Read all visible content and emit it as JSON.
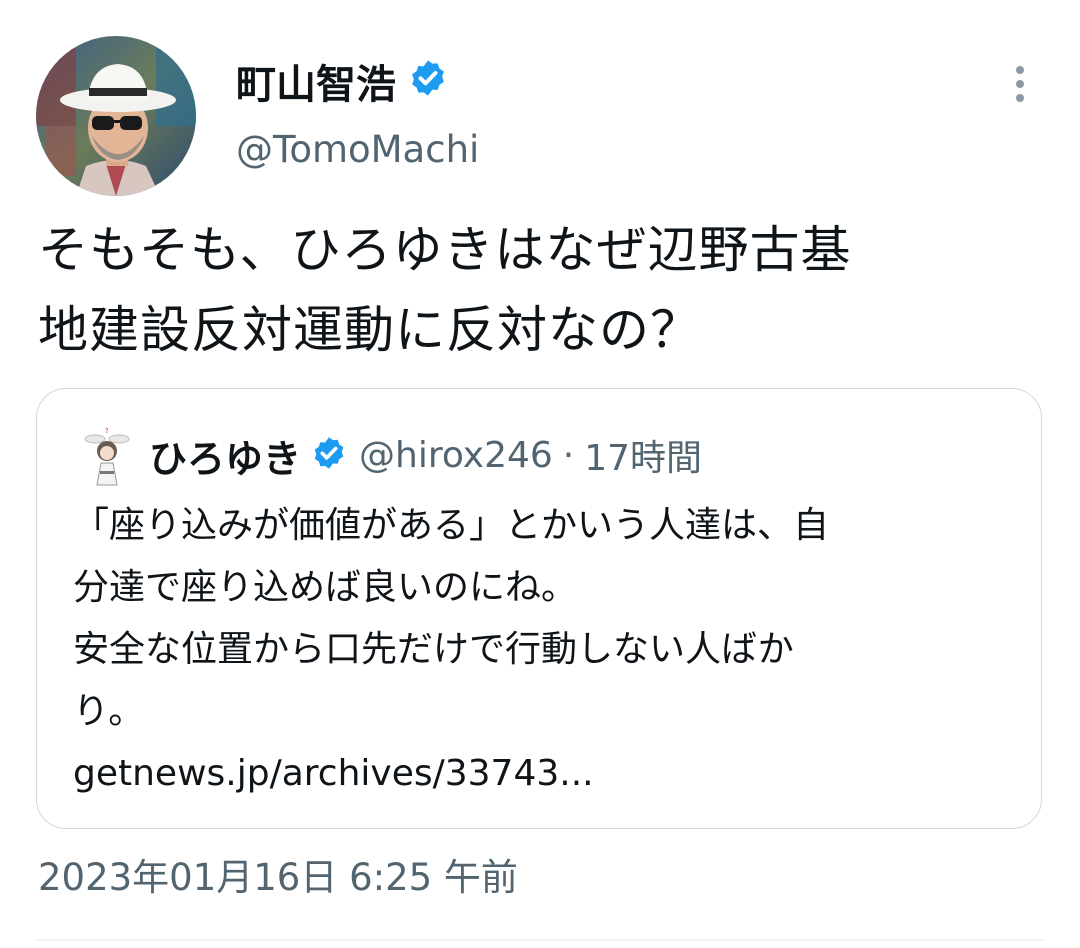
{
  "tweet": {
    "author": {
      "display_name": "町山智浩",
      "handle": "@TomoMachi",
      "verified": true
    },
    "text_lines": [
      "そもそも、ひろゆきはなぜ辺野古基",
      "地建設反対運動に反対なの？"
    ],
    "timestamp": "2023年01月16日 6:25 午前"
  },
  "quote": {
    "author": {
      "display_name": "ひろゆき",
      "handle": "@hirox246",
      "verified": true
    },
    "separator": "·",
    "time": "17時間",
    "text_lines": [
      "「座り込みが価値がある」とかいう人達は、自",
      "分達で座り込めば良いのにね。",
      "安全な位置から口先だけで行動しない人ばか",
      "り。",
      "getnews.jp/archives/33743..."
    ]
  },
  "icons": {
    "verified": "verified-badge-icon",
    "more": "more-options-icon"
  },
  "colors": {
    "verified_blue": "#1d9bf0",
    "secondary_text": "#536471",
    "border": "#cfd9de"
  }
}
